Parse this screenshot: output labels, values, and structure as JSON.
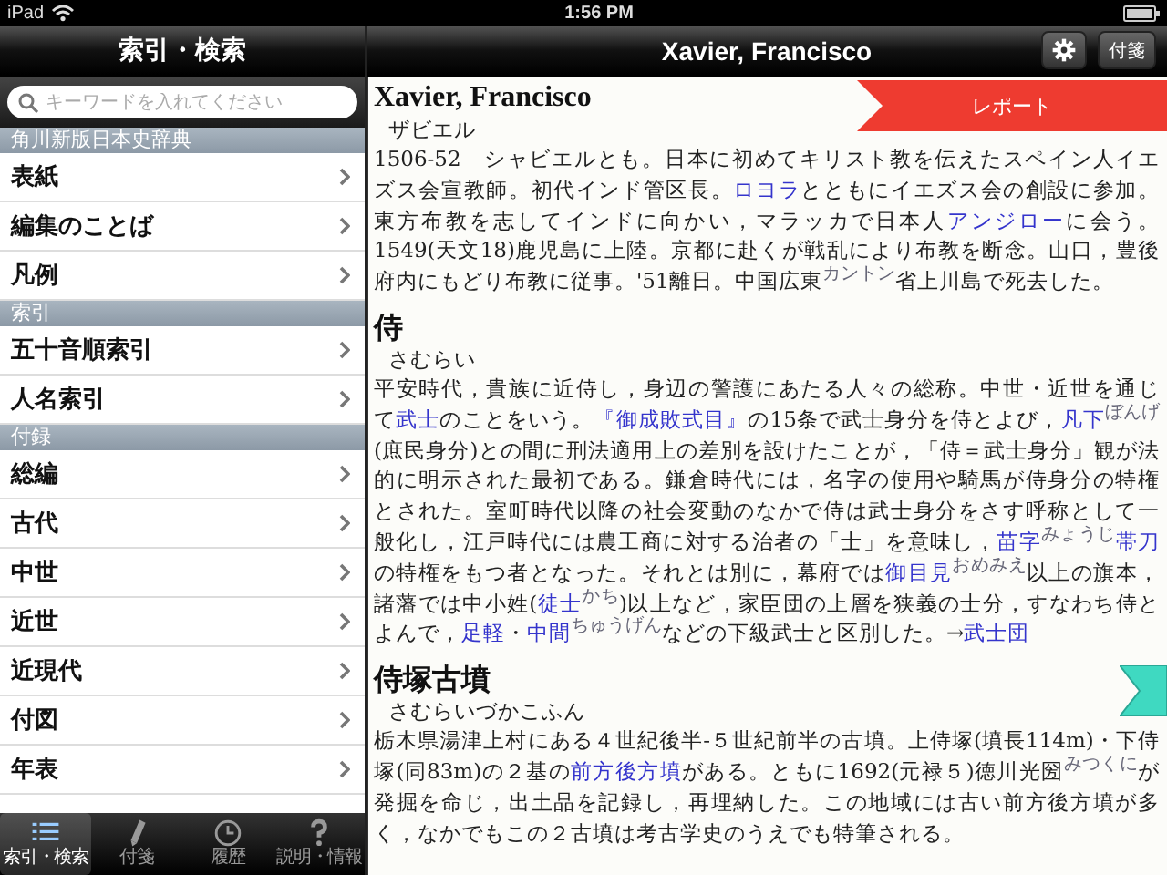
{
  "status_bar": {
    "device": "iPad",
    "time": "1:56 PM"
  },
  "sidebar": {
    "title": "索引・検索",
    "search": {
      "placeholder": "キーワードを入れてください"
    },
    "sections": [
      {
        "title": "角川新版日本史辞典",
        "items": [
          {
            "label": "表紙"
          },
          {
            "label": "編集のことば"
          },
          {
            "label": "凡例"
          }
        ]
      },
      {
        "title": "索引",
        "items": [
          {
            "label": "五十音順索引"
          },
          {
            "label": "人名索引"
          }
        ]
      },
      {
        "title": "付録",
        "items": [
          {
            "label": "総編"
          },
          {
            "label": "古代"
          },
          {
            "label": "中世"
          },
          {
            "label": "近世"
          },
          {
            "label": "近現代"
          },
          {
            "label": "付図"
          },
          {
            "label": "年表"
          }
        ]
      }
    ]
  },
  "tab_bar": [
    {
      "label": "索引・検索",
      "kind": "list",
      "selected": true
    },
    {
      "label": "付箋",
      "kind": "tag",
      "selected": false
    },
    {
      "label": "履歴",
      "kind": "clock",
      "selected": false
    },
    {
      "label": "説明・情報",
      "kind": "help",
      "selected": false
    }
  ],
  "article": {
    "title": "Xavier, Francisco",
    "buttons": [
      {
        "kind": "gear"
      },
      {
        "kind": "text",
        "label": "付箋"
      }
    ],
    "entries": [
      {
        "kind": "latin",
        "headword": "Xavier, Francisco",
        "reading": "ザビエル",
        "report": "レポート",
        "bookmarked": false,
        "body": [
          {
            "kind": "text",
            "t": "1506-52　シャビエルとも。日本に初めてキリスト教を伝えたスペイン人イエズス会宣教師。初代インド管区長。"
          },
          {
            "kind": "link",
            "t": "ロヨラ"
          },
          {
            "kind": "text",
            "t": "とともにイエズス会の創設に参加。東方布教を志してインドに向かい，マラッカで日本人"
          },
          {
            "kind": "link",
            "t": "アンジロー"
          },
          {
            "kind": "text",
            "t": "に会う。1549(天文18)鹿児島に上陸。京都に赴くが戦乱により布教を断念。山口，豊後府内にもどり布教に従事。'51離日。中国広東"
          },
          {
            "kind": "ruby",
            "t": "カントン"
          },
          {
            "kind": "text",
            "t": "省上川島で死去した。"
          }
        ]
      },
      {
        "kind": "kanji",
        "headword": "侍",
        "reading": "さむらい",
        "bookmarked": false,
        "body": [
          {
            "kind": "text",
            "t": "平安時代，貴族に近侍し，身辺の警護にあたる人々の総称。中世・近世を通じて"
          },
          {
            "kind": "link",
            "t": "武士"
          },
          {
            "kind": "text",
            "t": "のことをいう。"
          },
          {
            "kind": "link",
            "t": "『御成敗式目』"
          },
          {
            "kind": "text",
            "t": "の15条で武士身分を侍とよび，"
          },
          {
            "kind": "link",
            "t": "凡下"
          },
          {
            "kind": "ruby",
            "t": "ぼんげ"
          },
          {
            "kind": "text",
            "t": "(庶民身分)との間に刑法適用上の差別を設けたことが，「侍＝武士身分」観が法的に明示された最初である。鎌倉時代には，名字の使用や騎馬が侍身分の特権とされた。室町時代以降の社会変動のなかで侍は武士身分をさす呼称として一般化し，江戸時代には農工商に対する治者の「士」を意味し，"
          },
          {
            "kind": "link",
            "t": "苗字"
          },
          {
            "kind": "ruby",
            "t": "みょうじ"
          },
          {
            "kind": "link",
            "t": "帯刀"
          },
          {
            "kind": "text",
            "t": "の特権をもつ者となった。それとは別に，幕府では"
          },
          {
            "kind": "link",
            "t": "御目見"
          },
          {
            "kind": "ruby",
            "t": "おめみえ"
          },
          {
            "kind": "text",
            "t": "以上の旗本，諸藩では中小姓("
          },
          {
            "kind": "link",
            "t": "徒士"
          },
          {
            "kind": "ruby",
            "t": "かち"
          },
          {
            "kind": "text",
            "t": ")以上など，家臣団の上層を狭義の士分，すなわち侍とよんで，"
          },
          {
            "kind": "link",
            "t": "足軽"
          },
          {
            "kind": "text",
            "t": "・"
          },
          {
            "kind": "link",
            "t": "中間"
          },
          {
            "kind": "ruby",
            "t": "ちゅうげん"
          },
          {
            "kind": "text",
            "t": "などの下級武士と区別した。→"
          },
          {
            "kind": "link",
            "t": "武士団"
          }
        ]
      },
      {
        "kind": "kanji",
        "headword": "侍塚古墳",
        "reading": "さむらいづかこふん",
        "bookmarked": true,
        "body": [
          {
            "kind": "text",
            "t": "栃木県湯津上村にある４世紀後半-５世紀前半の古墳。上侍塚(墳長114m)・下侍塚(同83m)の２基の"
          },
          {
            "kind": "link",
            "t": "前方後方墳"
          },
          {
            "kind": "text",
            "t": "がある。ともに1692(元禄５)徳川光圀"
          },
          {
            "kind": "ruby",
            "t": "みつくに"
          },
          {
            "kind": "text",
            "t": "が発掘を命じ，出土品を記録し，再埋納した。この地域には古い前方後方墳が多く，なかでもこの２古墳は考古学史のうえでも特筆される。"
          }
        ]
      }
    ]
  }
}
